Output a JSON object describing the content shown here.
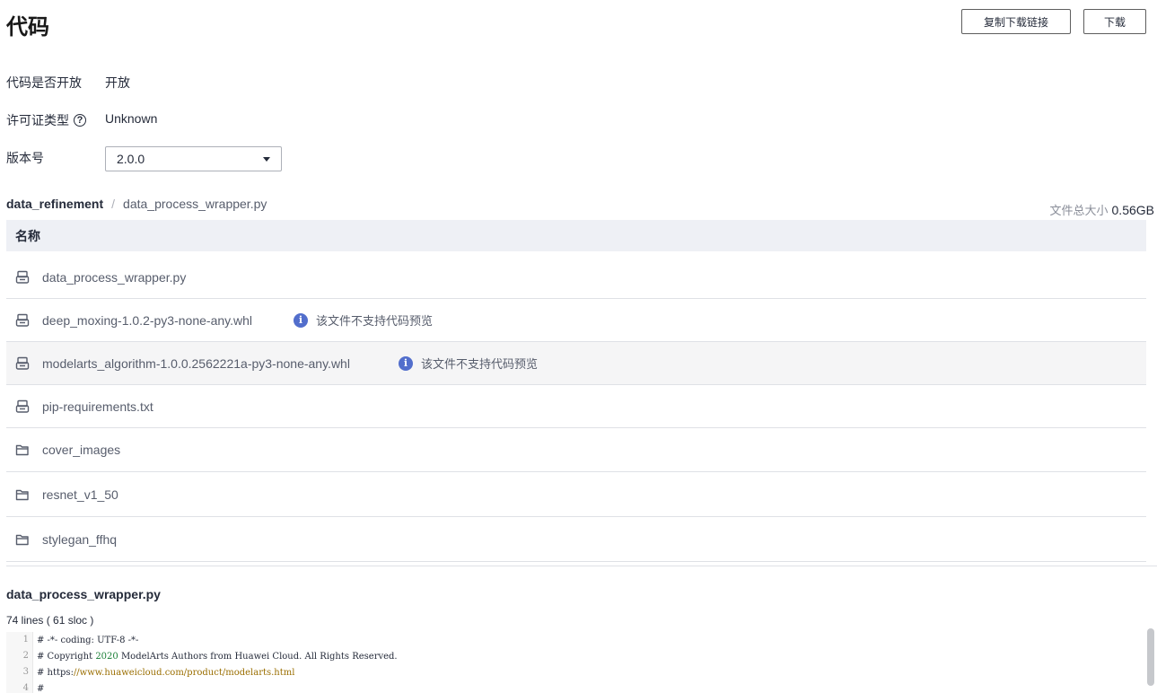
{
  "header": {
    "title": "代码",
    "copy_link_label": "复制下载链接",
    "download_label": "下载"
  },
  "info": {
    "open_label": "代码是否开放",
    "open_value": "开放",
    "license_label": "许可证类型",
    "license_value": "Unknown",
    "version_label": "版本号",
    "version_value": "2.0.0"
  },
  "breadcrumb": {
    "root": "data_refinement",
    "separator": "/",
    "current": "data_process_wrapper.py"
  },
  "total_size": {
    "label": "文件总大小",
    "value": "0.56GB"
  },
  "table": {
    "header_name": "名称",
    "rows": [
      {
        "name": "data_process_wrapper.py",
        "type": "file",
        "notice": ""
      },
      {
        "name": "deep_moxing-1.0.2-py3-none-any.whl",
        "type": "file",
        "notice": "该文件不支持代码预览"
      },
      {
        "name": "modelarts_algorithm-1.0.0.2562221a-py3-none-any.whl",
        "type": "file",
        "notice": "该文件不支持代码预览"
      },
      {
        "name": "pip-requirements.txt",
        "type": "file",
        "notice": ""
      },
      {
        "name": "cover_images",
        "type": "folder",
        "notice": ""
      },
      {
        "name": "resnet_v1_50",
        "type": "folder",
        "notice": ""
      },
      {
        "name": "stylegan_ffhq",
        "type": "folder",
        "notice": ""
      }
    ]
  },
  "code_view": {
    "filename": "data_process_wrapper.py",
    "stats": "74 lines ( 61 sloc )",
    "lines": [
      {
        "num": "1",
        "text": "# -*- coding: UTF-8 -*-"
      },
      {
        "num": "2",
        "text_pre": "# Copyright ",
        "year": "2020",
        "text_post": " ModelArts Authors from Huawei Cloud. All Rights Reserved."
      },
      {
        "num": "3",
        "text_pre": "# https:",
        "url": "//www.huaweicloud.com/product/modelarts.html"
      },
      {
        "num": "4",
        "text": "#"
      }
    ]
  },
  "colors": {
    "accent": "#526ecc",
    "header_bg": "#eef0f5",
    "highlight_row": "#f5f5f6"
  }
}
